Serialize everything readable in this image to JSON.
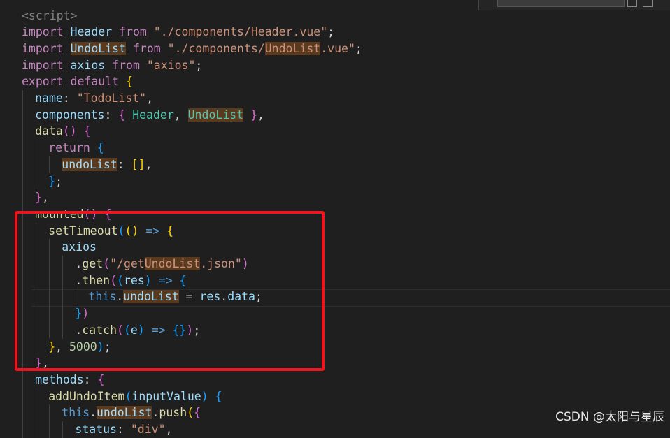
{
  "editor": {
    "language": "vue",
    "colors": {
      "background": "#1f1f1f",
      "keyword": "#c586c0",
      "keyword_blue": "#569cd6",
      "string": "#ce9178",
      "variable": "#9cdcfe",
      "function": "#dcdcaa",
      "class": "#4ec9b0",
      "number": "#b5cea8",
      "highlight_match": "#5a3a1e",
      "annotation_box": "#f0141e"
    },
    "lines": [
      {
        "indent": 0,
        "tokens": [
          {
            "t": "<script>",
            "c": "tag"
          }
        ]
      },
      {
        "indent": 0,
        "tokens": [
          {
            "t": "import",
            "c": "kw"
          },
          {
            "t": " "
          },
          {
            "t": "Header",
            "c": "id"
          },
          {
            "t": " "
          },
          {
            "t": "from",
            "c": "kw"
          },
          {
            "t": " "
          },
          {
            "t": "\"./components/Header.vue\"",
            "c": "str"
          },
          {
            "t": ";"
          }
        ]
      },
      {
        "indent": 0,
        "tokens": [
          {
            "t": "import",
            "c": "kw"
          },
          {
            "t": " "
          },
          {
            "t": "UndoList",
            "c": "id",
            "hl": true
          },
          {
            "t": " "
          },
          {
            "t": "from",
            "c": "kw"
          },
          {
            "t": " "
          },
          {
            "t": "\"./components/",
            "c": "str"
          },
          {
            "t": "UndoList",
            "c": "str",
            "hl": true
          },
          {
            "t": ".vue\"",
            "c": "str"
          },
          {
            "t": ";"
          }
        ]
      },
      {
        "indent": 0,
        "tokens": [
          {
            "t": "import",
            "c": "kw"
          },
          {
            "t": " "
          },
          {
            "t": "axios",
            "c": "id"
          },
          {
            "t": " "
          },
          {
            "t": "from",
            "c": "kw"
          },
          {
            "t": " "
          },
          {
            "t": "\"axios\"",
            "c": "str"
          },
          {
            "t": ";"
          }
        ]
      },
      {
        "indent": 0,
        "tokens": [
          {
            "t": "export",
            "c": "kw"
          },
          {
            "t": " "
          },
          {
            "t": "default",
            "c": "kw"
          },
          {
            "t": " "
          },
          {
            "t": "{",
            "c": "b1"
          }
        ]
      },
      {
        "indent": 1,
        "tokens": [
          {
            "t": "name",
            "c": "id"
          },
          {
            "t": ": "
          },
          {
            "t": "\"TodoList\"",
            "c": "str"
          },
          {
            "t": ","
          }
        ]
      },
      {
        "indent": 1,
        "tokens": [
          {
            "t": "components",
            "c": "id"
          },
          {
            "t": ": "
          },
          {
            "t": "{",
            "c": "b2"
          },
          {
            "t": " "
          },
          {
            "t": "Header",
            "c": "cls"
          },
          {
            "t": ", "
          },
          {
            "t": "UndoList",
            "c": "cls",
            "hl": true
          },
          {
            "t": " "
          },
          {
            "t": "}",
            "c": "b2"
          },
          {
            "t": ","
          }
        ]
      },
      {
        "indent": 1,
        "tokens": [
          {
            "t": "data",
            "c": "fn"
          },
          {
            "t": "()",
            "c": "b2"
          },
          {
            "t": " "
          },
          {
            "t": "{",
            "c": "b2"
          }
        ]
      },
      {
        "indent": 2,
        "tokens": [
          {
            "t": "return",
            "c": "kw"
          },
          {
            "t": " "
          },
          {
            "t": "{",
            "c": "b3"
          }
        ]
      },
      {
        "indent": 3,
        "tokens": [
          {
            "t": "undoList",
            "c": "id",
            "hl": true
          },
          {
            "t": ": "
          },
          {
            "t": "[]",
            "c": "b1"
          },
          {
            "t": ","
          }
        ]
      },
      {
        "indent": 2,
        "tokens": [
          {
            "t": "}",
            "c": "b3"
          },
          {
            "t": ";"
          }
        ]
      },
      {
        "indent": 1,
        "tokens": [
          {
            "t": "}",
            "c": "b2"
          },
          {
            "t": ","
          }
        ]
      },
      {
        "indent": 1,
        "tokens": [
          {
            "t": "mounted",
            "c": "fn"
          },
          {
            "t": "()",
            "c": "b2"
          },
          {
            "t": " "
          },
          {
            "t": "{",
            "c": "b2"
          }
        ]
      },
      {
        "indent": 2,
        "tokens": [
          {
            "t": "setTimeout",
            "c": "fn"
          },
          {
            "t": "(",
            "c": "b3"
          },
          {
            "t": "()",
            "c": "b1"
          },
          {
            "t": " "
          },
          {
            "t": "=>",
            "c": "kwb"
          },
          {
            "t": " "
          },
          {
            "t": "{",
            "c": "b1"
          }
        ]
      },
      {
        "indent": 3,
        "tokens": [
          {
            "t": "axios",
            "c": "id"
          }
        ]
      },
      {
        "indent": 4,
        "tokens": [
          {
            "t": "."
          },
          {
            "t": "get",
            "c": "fn"
          },
          {
            "t": "(",
            "c": "b2"
          },
          {
            "t": "\"/get",
            "c": "str"
          },
          {
            "t": "UndoList",
            "c": "str",
            "hl": true
          },
          {
            "t": ".json\"",
            "c": "str"
          },
          {
            "t": ")",
            "c": "b2"
          }
        ]
      },
      {
        "indent": 4,
        "tokens": [
          {
            "t": "."
          },
          {
            "t": "then",
            "c": "fn"
          },
          {
            "t": "(",
            "c": "b2"
          },
          {
            "t": "(",
            "c": "b3"
          },
          {
            "t": "res",
            "c": "id"
          },
          {
            "t": ")",
            "c": "b3"
          },
          {
            "t": " "
          },
          {
            "t": "=>",
            "c": "kwb"
          },
          {
            "t": " "
          },
          {
            "t": "{",
            "c": "b3"
          }
        ]
      },
      {
        "indent": 5,
        "tokens": [
          {
            "t": "this",
            "c": "kwb"
          },
          {
            "t": "."
          },
          {
            "t": "undoList",
            "c": "id",
            "hl": true
          },
          {
            "t": " = "
          },
          {
            "t": "res",
            "c": "id"
          },
          {
            "t": "."
          },
          {
            "t": "data",
            "c": "id"
          },
          {
            "t": ";"
          }
        ]
      },
      {
        "indent": 4,
        "tokens": [
          {
            "t": "}",
            "c": "b3"
          },
          {
            "t": ")",
            "c": "b2"
          }
        ]
      },
      {
        "indent": 4,
        "tokens": [
          {
            "t": "."
          },
          {
            "t": "catch",
            "c": "fn"
          },
          {
            "t": "(",
            "c": "b2"
          },
          {
            "t": "(",
            "c": "b3"
          },
          {
            "t": "e",
            "c": "id"
          },
          {
            "t": ")",
            "c": "b3"
          },
          {
            "t": " "
          },
          {
            "t": "=>",
            "c": "kwb"
          },
          {
            "t": " "
          },
          {
            "t": "{}",
            "c": "b3"
          },
          {
            "t": ")",
            "c": "b2"
          },
          {
            "t": ";"
          }
        ]
      },
      {
        "indent": 2,
        "tokens": [
          {
            "t": "}",
            "c": "b1"
          },
          {
            "t": ", "
          },
          {
            "t": "5000",
            "c": "num"
          },
          {
            "t": ")",
            "c": "b3"
          },
          {
            "t": ";"
          }
        ]
      },
      {
        "indent": 1,
        "tokens": [
          {
            "t": "}",
            "c": "b2"
          },
          {
            "t": ","
          }
        ]
      },
      {
        "indent": 1,
        "tokens": [
          {
            "t": "methods",
            "c": "id"
          },
          {
            "t": ": "
          },
          {
            "t": "{",
            "c": "b2"
          }
        ]
      },
      {
        "indent": 2,
        "tokens": [
          {
            "t": "addUndoItem",
            "c": "fn"
          },
          {
            "t": "(",
            "c": "b3"
          },
          {
            "t": "inputValue",
            "c": "id"
          },
          {
            "t": ")",
            "c": "b3"
          },
          {
            "t": " "
          },
          {
            "t": "{",
            "c": "b3"
          }
        ]
      },
      {
        "indent": 3,
        "tokens": [
          {
            "t": "this",
            "c": "kwb"
          },
          {
            "t": "."
          },
          {
            "t": "undoList",
            "c": "id",
            "hl": true
          },
          {
            "t": "."
          },
          {
            "t": "push",
            "c": "fn"
          },
          {
            "t": "(",
            "c": "b1"
          },
          {
            "t": "{",
            "c": "b2"
          }
        ]
      },
      {
        "indent": 4,
        "tokens": [
          {
            "t": "status",
            "c": "id"
          },
          {
            "t": ": "
          },
          {
            "t": "\"div\"",
            "c": "str"
          },
          {
            "t": ","
          }
        ]
      }
    ]
  },
  "watermark": "CSDN @太阳与星辰"
}
